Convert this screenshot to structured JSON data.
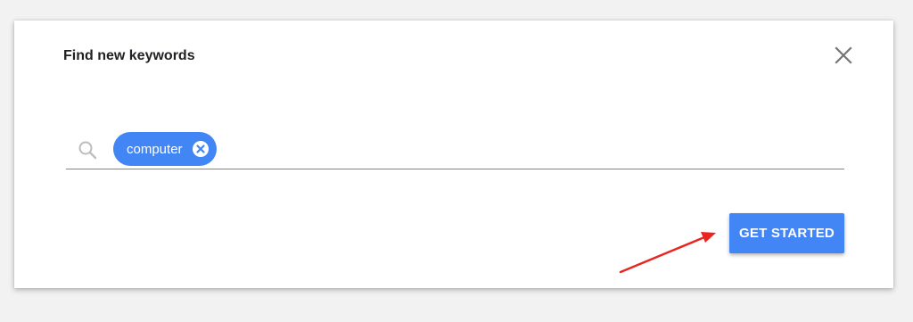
{
  "dialog": {
    "title": "Find new keywords"
  },
  "search": {
    "chips": [
      {
        "label": "computer"
      }
    ]
  },
  "actions": {
    "get_started_label": "GET STARTED"
  },
  "icons": {
    "close": "close-icon",
    "search": "search-icon",
    "chip_remove": "chip-remove-icon"
  },
  "colors": {
    "accent": "#4285f4",
    "annotation_arrow": "#e8251f",
    "underline": "#4c8ee0"
  }
}
